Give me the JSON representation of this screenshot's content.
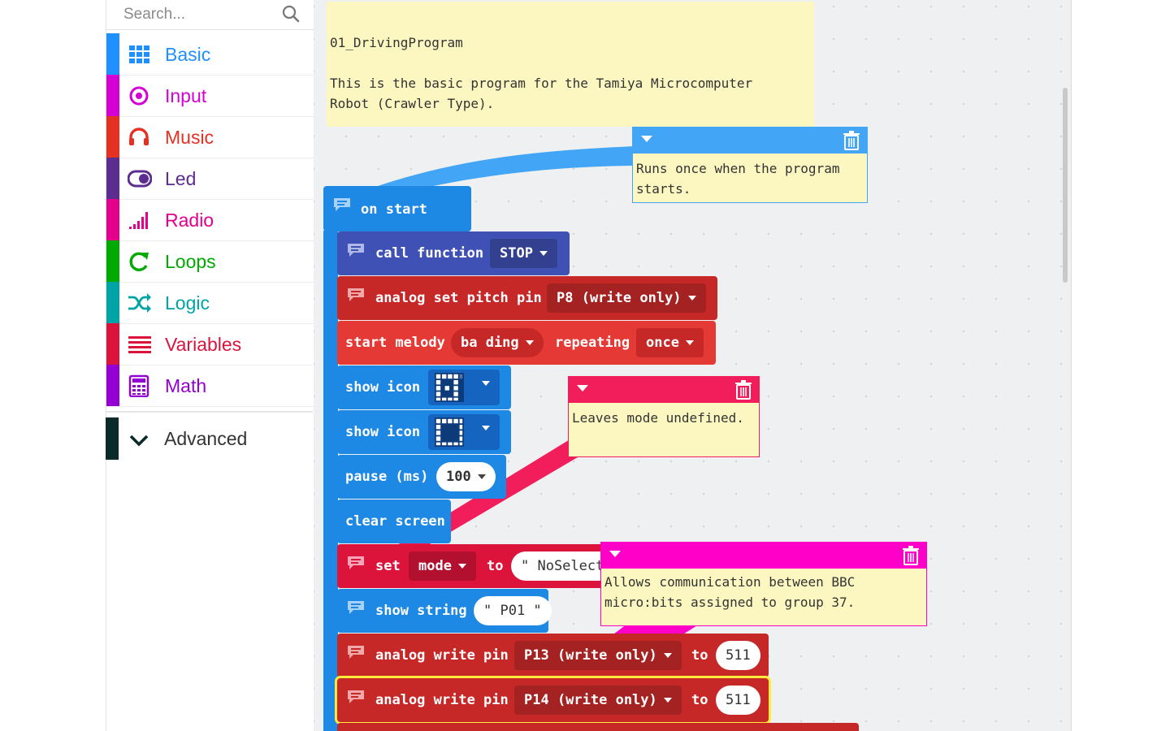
{
  "search": {
    "placeholder": "Search..."
  },
  "categories": [
    {
      "label": "Basic",
      "color": "#1e90ff",
      "icon": "grid-icon"
    },
    {
      "label": "Input",
      "color": "#d400d4",
      "icon": "target-icon"
    },
    {
      "label": "Music",
      "color": "#e63022",
      "icon": "headphones-icon"
    },
    {
      "label": "Led",
      "color": "#5c2d91",
      "icon": "toggle-icon"
    },
    {
      "label": "Radio",
      "color": "#e3008c",
      "icon": "signal-bars-icon"
    },
    {
      "label": "Loops",
      "color": "#00aa00",
      "icon": "refresh-icon"
    },
    {
      "label": "Logic",
      "color": "#00a4a6",
      "icon": "shuffle-icon"
    },
    {
      "label": "Variables",
      "color": "#dc143c",
      "icon": "list-lines-icon"
    },
    {
      "label": "Math",
      "color": "#9400d3",
      "icon": "calculator-icon"
    }
  ],
  "advanced": {
    "label": "Advanced",
    "icon": "chevron-down-icon"
  },
  "comments": {
    "header_note": "01_DrivingProgram\n\nThis is the basic program for the Tamiya Microcomputer\nRobot (Crawler Type).",
    "on_start_note": "Runs once when the program\nstarts.",
    "mode_note": "Leaves mode undefined.",
    "radio_note": "Allows communication between BBC\nmicro:bits assigned to group 37."
  },
  "blocks": {
    "on_start": "on start",
    "call_function": "call function",
    "function_name": "STOP",
    "analog_set_pitch": "analog set pitch pin",
    "pitch_pin": "P8 (write only)",
    "start_melody": "start melody",
    "melody": "ba ding",
    "repeating": "repeating",
    "repeat_mode": "once",
    "show_icon_1": "show icon",
    "show_icon_2": "show icon",
    "pause": "pause (ms)",
    "pause_value": "100",
    "clear_screen": "clear screen",
    "set": "set",
    "variable": "mode",
    "to": "to",
    "set_value": "\" NoSelect",
    "show_string": "show string",
    "string_value": "\" P01 \"",
    "analog_write_1": "analog write pin",
    "write_pin_1": "P13 (write only)",
    "to_1": "to",
    "write_value_1": "511",
    "analog_write_2": "analog write pin",
    "write_pin_2": "P14 (write only)",
    "to_2": "to",
    "write_value_2": "511"
  },
  "colors": {
    "basic_blue": "#1e88e5",
    "music_red": "#d32f2f",
    "variables_red": "#dc143c",
    "radio_pink": "#e3008c",
    "selected_outline": "#ffeb3b"
  }
}
